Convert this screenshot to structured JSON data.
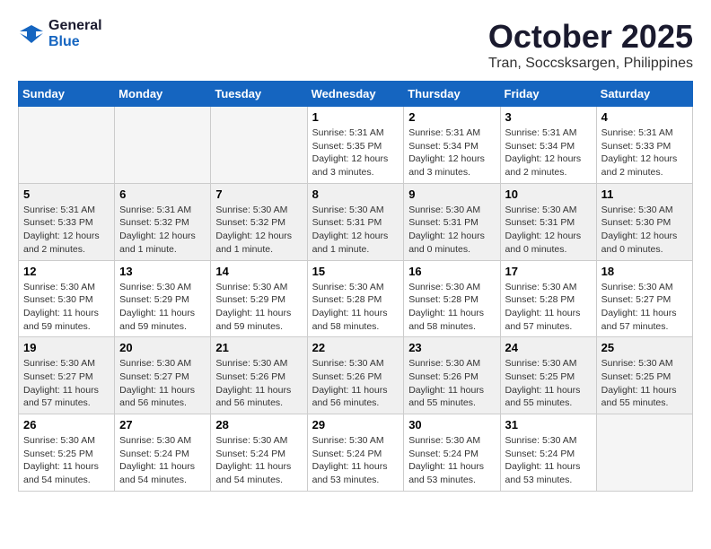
{
  "logo": {
    "line1": "General",
    "line2": "Blue"
  },
  "title": "October 2025",
  "location": "Tran, Soccsksargen, Philippines",
  "days_of_week": [
    "Sunday",
    "Monday",
    "Tuesday",
    "Wednesday",
    "Thursday",
    "Friday",
    "Saturday"
  ],
  "weeks": [
    [
      {
        "day": "",
        "info": ""
      },
      {
        "day": "",
        "info": ""
      },
      {
        "day": "",
        "info": ""
      },
      {
        "day": "1",
        "info": "Sunrise: 5:31 AM\nSunset: 5:35 PM\nDaylight: 12 hours and 3 minutes."
      },
      {
        "day": "2",
        "info": "Sunrise: 5:31 AM\nSunset: 5:34 PM\nDaylight: 12 hours and 3 minutes."
      },
      {
        "day": "3",
        "info": "Sunrise: 5:31 AM\nSunset: 5:34 PM\nDaylight: 12 hours and 2 minutes."
      },
      {
        "day": "4",
        "info": "Sunrise: 5:31 AM\nSunset: 5:33 PM\nDaylight: 12 hours and 2 minutes."
      }
    ],
    [
      {
        "day": "5",
        "info": "Sunrise: 5:31 AM\nSunset: 5:33 PM\nDaylight: 12 hours and 2 minutes."
      },
      {
        "day": "6",
        "info": "Sunrise: 5:31 AM\nSunset: 5:32 PM\nDaylight: 12 hours and 1 minute."
      },
      {
        "day": "7",
        "info": "Sunrise: 5:30 AM\nSunset: 5:32 PM\nDaylight: 12 hours and 1 minute."
      },
      {
        "day": "8",
        "info": "Sunrise: 5:30 AM\nSunset: 5:31 PM\nDaylight: 12 hours and 1 minute."
      },
      {
        "day": "9",
        "info": "Sunrise: 5:30 AM\nSunset: 5:31 PM\nDaylight: 12 hours and 0 minutes."
      },
      {
        "day": "10",
        "info": "Sunrise: 5:30 AM\nSunset: 5:31 PM\nDaylight: 12 hours and 0 minutes."
      },
      {
        "day": "11",
        "info": "Sunrise: 5:30 AM\nSunset: 5:30 PM\nDaylight: 12 hours and 0 minutes."
      }
    ],
    [
      {
        "day": "12",
        "info": "Sunrise: 5:30 AM\nSunset: 5:30 PM\nDaylight: 11 hours and 59 minutes."
      },
      {
        "day": "13",
        "info": "Sunrise: 5:30 AM\nSunset: 5:29 PM\nDaylight: 11 hours and 59 minutes."
      },
      {
        "day": "14",
        "info": "Sunrise: 5:30 AM\nSunset: 5:29 PM\nDaylight: 11 hours and 59 minutes."
      },
      {
        "day": "15",
        "info": "Sunrise: 5:30 AM\nSunset: 5:28 PM\nDaylight: 11 hours and 58 minutes."
      },
      {
        "day": "16",
        "info": "Sunrise: 5:30 AM\nSunset: 5:28 PM\nDaylight: 11 hours and 58 minutes."
      },
      {
        "day": "17",
        "info": "Sunrise: 5:30 AM\nSunset: 5:28 PM\nDaylight: 11 hours and 57 minutes."
      },
      {
        "day": "18",
        "info": "Sunrise: 5:30 AM\nSunset: 5:27 PM\nDaylight: 11 hours and 57 minutes."
      }
    ],
    [
      {
        "day": "19",
        "info": "Sunrise: 5:30 AM\nSunset: 5:27 PM\nDaylight: 11 hours and 57 minutes."
      },
      {
        "day": "20",
        "info": "Sunrise: 5:30 AM\nSunset: 5:27 PM\nDaylight: 11 hours and 56 minutes."
      },
      {
        "day": "21",
        "info": "Sunrise: 5:30 AM\nSunset: 5:26 PM\nDaylight: 11 hours and 56 minutes."
      },
      {
        "day": "22",
        "info": "Sunrise: 5:30 AM\nSunset: 5:26 PM\nDaylight: 11 hours and 56 minutes."
      },
      {
        "day": "23",
        "info": "Sunrise: 5:30 AM\nSunset: 5:26 PM\nDaylight: 11 hours and 55 minutes."
      },
      {
        "day": "24",
        "info": "Sunrise: 5:30 AM\nSunset: 5:25 PM\nDaylight: 11 hours and 55 minutes."
      },
      {
        "day": "25",
        "info": "Sunrise: 5:30 AM\nSunset: 5:25 PM\nDaylight: 11 hours and 55 minutes."
      }
    ],
    [
      {
        "day": "26",
        "info": "Sunrise: 5:30 AM\nSunset: 5:25 PM\nDaylight: 11 hours and 54 minutes."
      },
      {
        "day": "27",
        "info": "Sunrise: 5:30 AM\nSunset: 5:24 PM\nDaylight: 11 hours and 54 minutes."
      },
      {
        "day": "28",
        "info": "Sunrise: 5:30 AM\nSunset: 5:24 PM\nDaylight: 11 hours and 54 minutes."
      },
      {
        "day": "29",
        "info": "Sunrise: 5:30 AM\nSunset: 5:24 PM\nDaylight: 11 hours and 53 minutes."
      },
      {
        "day": "30",
        "info": "Sunrise: 5:30 AM\nSunset: 5:24 PM\nDaylight: 11 hours and 53 minutes."
      },
      {
        "day": "31",
        "info": "Sunrise: 5:30 AM\nSunset: 5:24 PM\nDaylight: 11 hours and 53 minutes."
      },
      {
        "day": "",
        "info": ""
      }
    ]
  ]
}
